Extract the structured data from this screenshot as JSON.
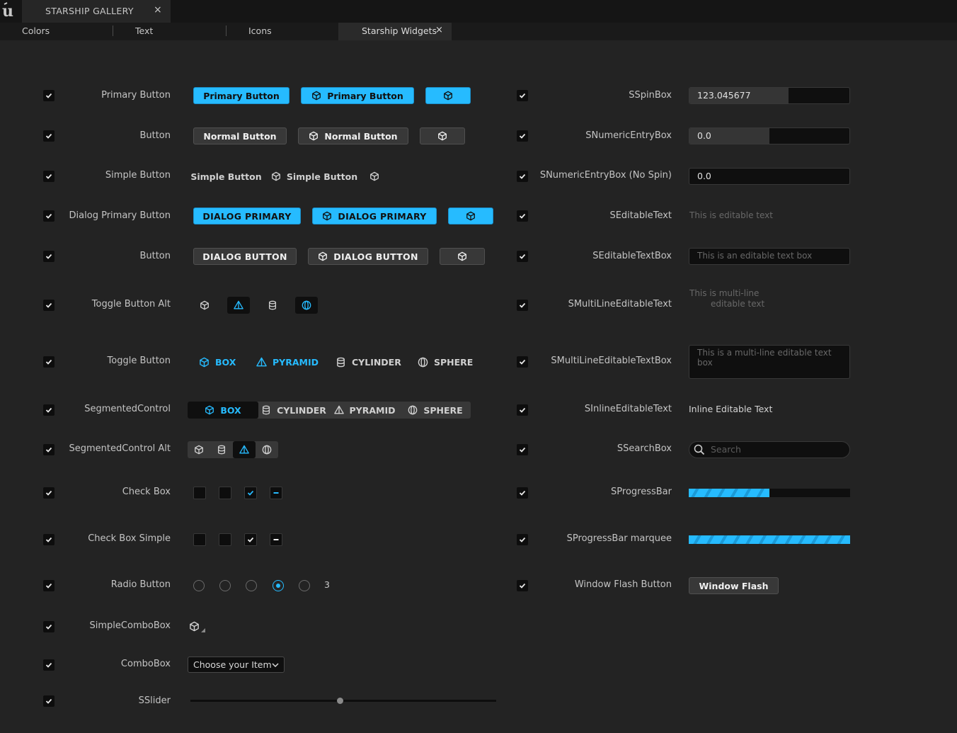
{
  "app": {
    "document_tab": "STARSHIP GALLERY",
    "close_glyph": "×"
  },
  "tabs": [
    {
      "label": "Colors"
    },
    {
      "label": "Text"
    },
    {
      "label": "Icons"
    },
    {
      "label": "Starship Widgets",
      "active": true
    }
  ],
  "colors": {
    "accent": "#26bbff",
    "panel": "#232323",
    "field": "#0f0f0f"
  },
  "left": {
    "rows": [
      {
        "label": "Primary Button",
        "buttons": [
          "Primary Button",
          "Primary Button"
        ]
      },
      {
        "label": "Button",
        "buttons": [
          "Normal Button",
          "Normal Button"
        ]
      },
      {
        "label": "Simple Button",
        "buttons": [
          "Simple Button",
          "Simple Button"
        ]
      },
      {
        "label": "Dialog Primary Button",
        "buttons": [
          "DIALOG PRIMARY",
          "DIALOG PRIMARY"
        ]
      },
      {
        "label": "Button",
        "buttons": [
          "DIALOG BUTTON",
          "DIALOG BUTTON"
        ]
      },
      {
        "label": "Toggle Button Alt"
      },
      {
        "label": "Toggle Button",
        "options": [
          "BOX",
          "PYRAMID",
          "CYLINDER",
          "SPHERE"
        ]
      },
      {
        "label": "SegmentedControl",
        "options": [
          "BOX",
          "CYLINDER",
          "PYRAMID",
          "SPHERE"
        ]
      },
      {
        "label": "SegmentedControl Alt"
      },
      {
        "label": "Check Box"
      },
      {
        "label": "Check Box Simple"
      },
      {
        "label": "Radio Button",
        "value": "3"
      },
      {
        "label": "SimpleComboBox"
      },
      {
        "label": "ComboBox",
        "value": "Choose your Item"
      },
      {
        "label": "SSlider",
        "value": 0.5
      }
    ]
  },
  "right": {
    "rows": [
      {
        "label": "SSpinBox",
        "value": "123.045677",
        "fill": 0.62
      },
      {
        "label": "SNumericEntryBox",
        "value": "0.0",
        "fill": 0.5
      },
      {
        "label": "SNumericEntryBox (No Spin)",
        "value": "0.0"
      },
      {
        "label": "SEditableText",
        "value": "This is editable text"
      },
      {
        "label": "SEditableTextBox",
        "value": "This is an editable text box"
      },
      {
        "label": "SMultiLineEditableText",
        "line1": "This is multi-line",
        "line2": "editable text"
      },
      {
        "label": "SMultiLineEditableTextBox",
        "value": "This is a multi-line editable text box"
      },
      {
        "label": "SInlineEditableText",
        "value": "Inline Editable Text"
      },
      {
        "label": "SSearchBox",
        "placeholder": "Search"
      },
      {
        "label": "SProgressBar",
        "progress": 0.5
      },
      {
        "label": "SProgressBar marquee"
      },
      {
        "label": "Window Flash Button",
        "button": "Window Flash"
      }
    ]
  }
}
